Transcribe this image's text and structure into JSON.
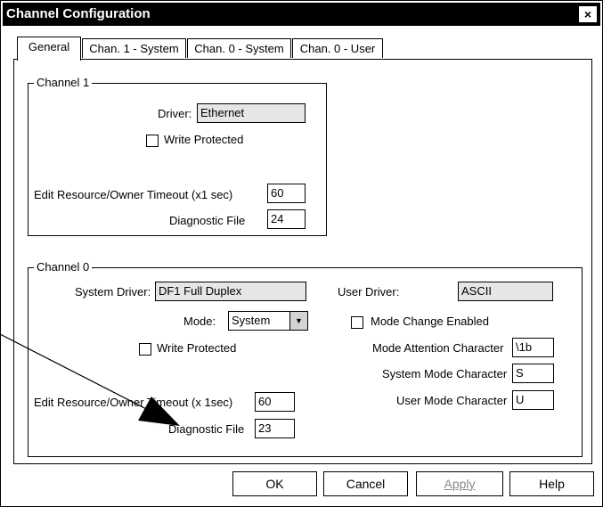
{
  "window": {
    "title": "Channel Configuration",
    "close_glyph": "×"
  },
  "tabs": [
    "General",
    "Chan. 1 - System",
    "Chan. 0 - System",
    "Chan. 0 - User"
  ],
  "channel1": {
    "legend": "Channel 1",
    "driver_label": "Driver:",
    "driver_value": "Ethernet",
    "write_protected_label": "Write Protected",
    "write_protected": false,
    "timeout_label": "Edit Resource/Owner Timeout (x1 sec)",
    "timeout_value": "60",
    "diag_file_label": "Diagnostic File",
    "diag_file_value": "24"
  },
  "channel0": {
    "legend": "Channel 0",
    "system_driver_label": "System Driver:",
    "system_driver_value": "DF1 Full Duplex",
    "user_driver_label": "User Driver:",
    "user_driver_value": "ASCII",
    "mode_label": "Mode:",
    "mode_value": "System",
    "mode_change_label": "Mode Change Enabled",
    "mode_change_enabled": false,
    "write_protected_label": "Write Protected",
    "write_protected": false,
    "attention_char_label": "Mode Attention Character",
    "attention_char_value": "\\1b",
    "system_mode_char_label": "System Mode Character",
    "system_mode_char_value": "S",
    "timeout_label": "Edit Resource/Owner Timeout (x 1sec)",
    "timeout_value": "60",
    "user_mode_char_label": "User Mode Character",
    "user_mode_char_value": "U",
    "diag_file_label": "Diagnostic File",
    "diag_file_value": "23"
  },
  "buttons": {
    "ok": "OK",
    "cancel": "Cancel",
    "apply": "Apply",
    "help": "Help"
  }
}
